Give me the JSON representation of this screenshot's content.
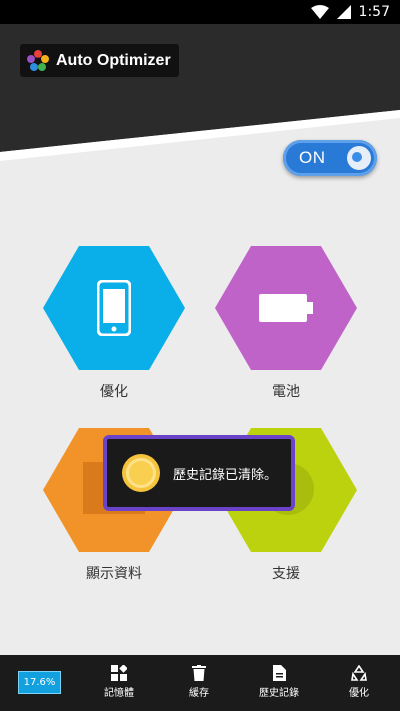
{
  "status_bar": {
    "time": "1:57"
  },
  "app": {
    "title": "Auto Optimizer"
  },
  "toggle": {
    "label": "ON",
    "state": "on"
  },
  "tiles": [
    {
      "label": "優化",
      "color": "#0aaee8",
      "icon": "phone-icon"
    },
    {
      "label": "電池",
      "color": "#c063c9",
      "icon": "battery-icon"
    },
    {
      "label": "顯示資料",
      "color": "#f2932a",
      "icon": "display-icon"
    },
    {
      "label": "支援",
      "color": "#bcd20e",
      "icon": "support-icon"
    }
  ],
  "toast": {
    "message": "歷史記錄已清除。"
  },
  "bottom_bar": {
    "percent": "17.6%",
    "items": [
      {
        "label": "記憶體",
        "icon": "memory-icon"
      },
      {
        "label": "緩存",
        "icon": "trash-icon"
      },
      {
        "label": "歷史記錄",
        "icon": "document-icon"
      },
      {
        "label": "優化",
        "icon": "recycle-icon"
      }
    ]
  },
  "colors": {
    "header_dark": "#2b2b2b",
    "toggle_blue": "#2979d6",
    "toast_border": "#6a43c8",
    "badge_blue": "#13a0df"
  }
}
